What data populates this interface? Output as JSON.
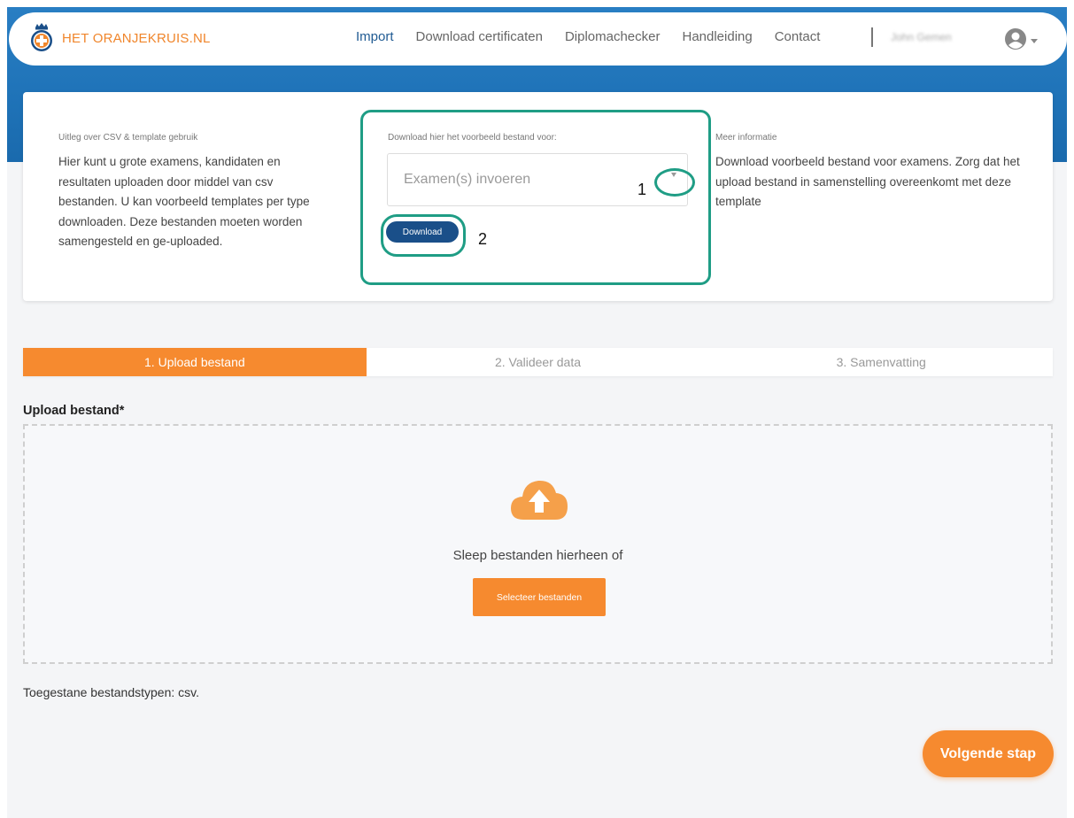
{
  "brand": {
    "name": "HET ORANJEKRUIS.NL",
    "color": "#f0862c"
  },
  "nav": {
    "items": [
      {
        "label": "Import",
        "active": true
      },
      {
        "label": "Download certificaten",
        "active": false
      },
      {
        "label": "Diplomachecker",
        "active": false
      },
      {
        "label": "Handleiding",
        "active": false
      },
      {
        "label": "Contact",
        "active": false
      }
    ],
    "user_name": "John Gemen",
    "avatar_icon": "user-circle-icon"
  },
  "info": {
    "left": {
      "label": "Uitleg over CSV & template gebruik",
      "text": "Hier kunt u grote examens, kandidaten en resultaten uploaden door middel van csv bestanden. U kan voorbeeld templates per type downloaden. Deze bestanden moeten worden samengesteld en ge-uploaded."
    },
    "middle": {
      "label": "Download hier het voorbeeld bestand voor:",
      "select_placeholder": "Examen(s) invoeren",
      "download_label": "Download"
    },
    "right": {
      "label": "Meer informatie",
      "text": "Download voorbeeld bestand voor examens. Zorg dat het upload bestand in samenstelling overeenkomt met deze template"
    }
  },
  "annotations": {
    "one": "1",
    "two": "2",
    "color": "#1f9d85"
  },
  "steps": [
    {
      "label": "1. Upload bestand",
      "active": true
    },
    {
      "label": "2. Valideer data",
      "active": false
    },
    {
      "label": "3. Samenvatting",
      "active": false
    }
  ],
  "upload": {
    "title": "Upload bestand*",
    "drop_text": "Sleep bestanden hierheen of",
    "select_button": "Selecteer bestanden",
    "allowed": "Toegestane bestandstypen: csv.",
    "icon": "cloud-upload-icon"
  },
  "next_button": "Volgende stap",
  "colors": {
    "accent": "#f68a2f",
    "primary": "#1a4f89",
    "header": "#1f73b8"
  }
}
